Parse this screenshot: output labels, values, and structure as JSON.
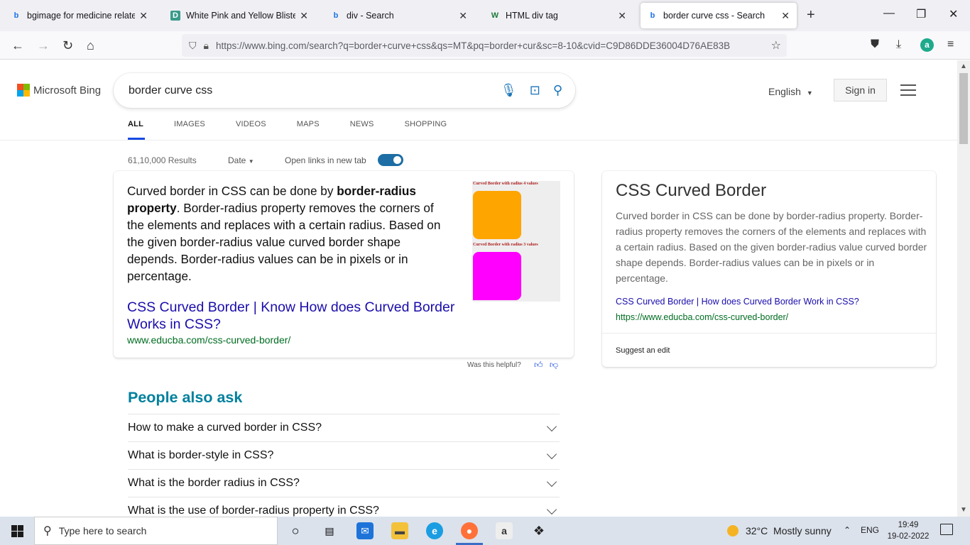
{
  "browser": {
    "tabs": [
      {
        "title": "bgimage for medicine related w",
        "favicon": "bing"
      },
      {
        "title": "White Pink and Yellow Blister Pa",
        "favicon": "D"
      },
      {
        "title": "div - Search",
        "favicon": "bing"
      },
      {
        "title": "HTML div tag",
        "favicon": "W"
      },
      {
        "title": "border curve css - Search",
        "favicon": "bing"
      }
    ],
    "url": "https://www.bing.com/search?q=border+curve+css&qs=MT&pq=border+cur&sc=8-10&cvid=C9D86DDE36004D76AE83B"
  },
  "header": {
    "logo_text": "Microsoft Bing",
    "query": "border curve css",
    "language": "English",
    "sign_in": "Sign in"
  },
  "scopes": [
    "ALL",
    "IMAGES",
    "VIDEOS",
    "MAPS",
    "NEWS",
    "SHOPPING"
  ],
  "results_bar": {
    "count": "61,10,000 Results",
    "date_filter": "Date",
    "open_links": "Open links in new tab"
  },
  "answer": {
    "text_pre": "Curved border in CSS can be done by ",
    "text_bold": "border-radius property",
    "text_post": ". Border-radius property removes the corners of the elements and replaces with a certain radius. Based on the given border-radius value curved border shape depends. Border-radius values can be in pixels or in percentage.",
    "thumb_caption_1": "Curved Border with radius 4 values",
    "thumb_caption_2": "Curved Border with radius 3 values",
    "link_title": "CSS Curved Border | Know How does Curved Border Works in CSS?",
    "cite": "www.educba.com/css-curved-border/",
    "helpful": "Was this helpful?"
  },
  "people_also_ask": {
    "title": "People also ask",
    "questions": [
      "How to make a curved border in CSS?",
      "What is border-style in CSS?",
      "What is the border radius in CSS?",
      "What is the use of border-radius property in CSS?"
    ]
  },
  "sidecard": {
    "title": "CSS Curved Border",
    "text": "Curved border in CSS can be done by border-radius property. Border-radius property removes the corners of the elements and replaces with a certain radius. Based on the given border-radius value curved border shape depends. Border-radius values can be in pixels or in percentage.",
    "link": "CSS Curved Border | How does Curved Border Work in CSS?",
    "url": "https://www.educba.com/css-curved-border/",
    "suggest": "Suggest an edit"
  },
  "taskbar": {
    "search_placeholder": "Type here to search",
    "weather": "32°C  Mostly sunny",
    "lang": "ENG",
    "time": "19:49",
    "date": "19-02-2022"
  },
  "colors": {
    "link": "#1a0dab",
    "cite": "#006d21",
    "accent": "#174ae4",
    "paa_title": "#00809d"
  }
}
